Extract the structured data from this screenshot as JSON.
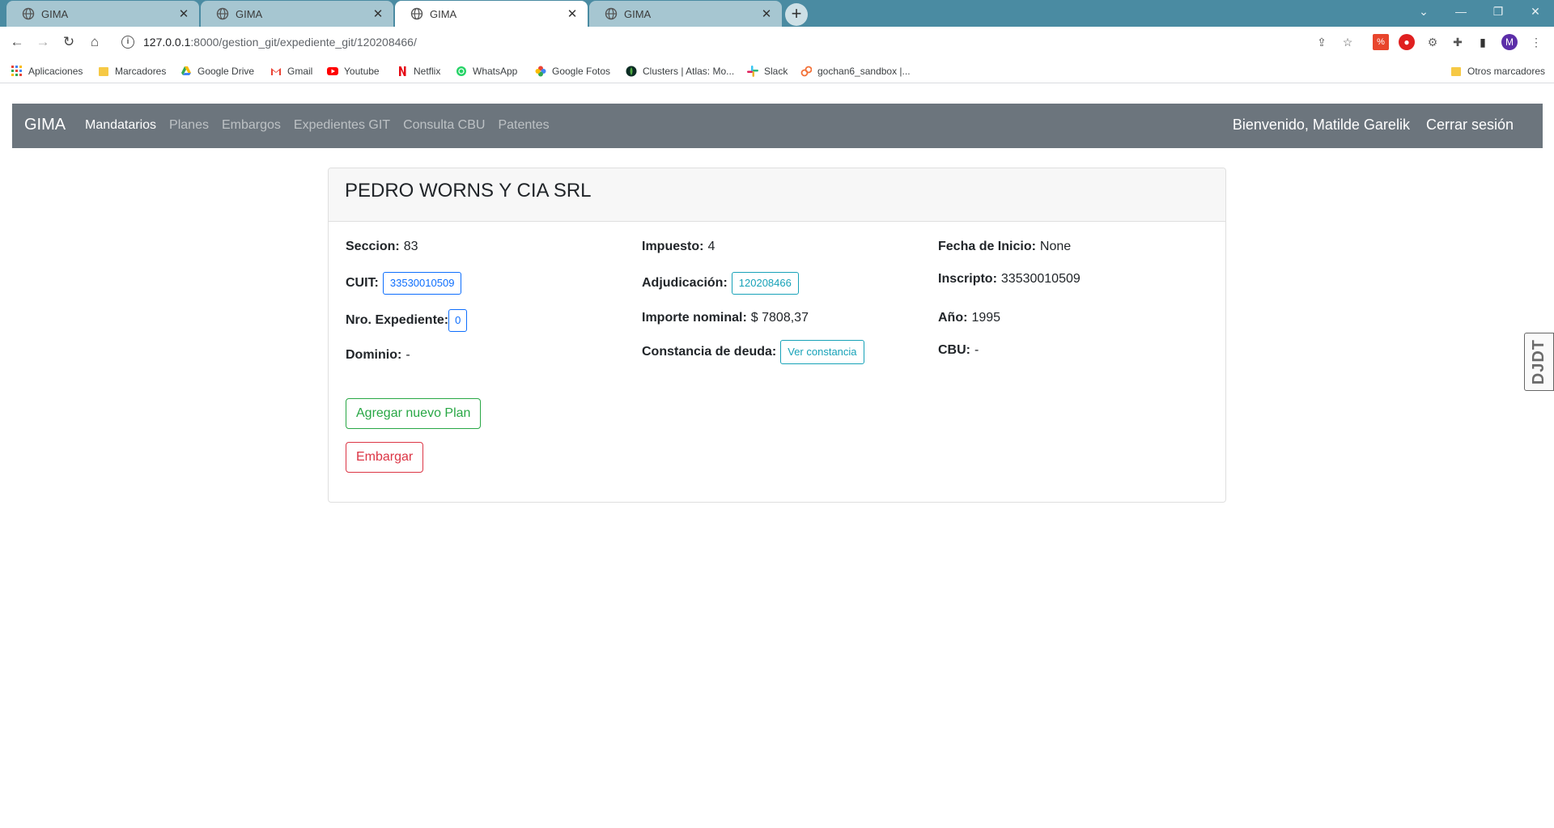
{
  "browser": {
    "tabs": [
      {
        "title": "GIMA",
        "active": false
      },
      {
        "title": "GIMA",
        "active": false
      },
      {
        "title": "GIMA",
        "active": true
      },
      {
        "title": "GIMA",
        "active": false
      }
    ],
    "url_host": "127.0.0.1",
    "url_rest": ":8000/gestion_git/expediente_git/120208466/",
    "profile_initial": "M",
    "bookmarks": [
      {
        "label": "Aplicaciones",
        "icon": "apps-grid-icon"
      },
      {
        "label": "Marcadores",
        "icon": "folder-icon"
      },
      {
        "label": "Google Drive",
        "icon": "google-drive-icon"
      },
      {
        "label": "Gmail",
        "icon": "gmail-icon"
      },
      {
        "label": "Youtube",
        "icon": "youtube-icon"
      },
      {
        "label": "Netflix",
        "icon": "netflix-icon"
      },
      {
        "label": "WhatsApp",
        "icon": "whatsapp-icon"
      },
      {
        "label": "Google Fotos",
        "icon": "google-photos-icon"
      },
      {
        "label": "Clusters | Atlas: Mo...",
        "icon": "mongodb-icon"
      },
      {
        "label": "Slack",
        "icon": "slack-icon"
      },
      {
        "label": "gochan6_sandbox |...",
        "icon": "postman-icon"
      }
    ],
    "other_bookmarks": "Otros marcadores"
  },
  "app": {
    "brand": "GIMA",
    "nav": [
      {
        "label": "Mandatarios",
        "active": true
      },
      {
        "label": "Planes",
        "active": false
      },
      {
        "label": "Embargos",
        "active": false
      },
      {
        "label": "Expedientes GIT",
        "active": false
      },
      {
        "label": "Consulta CBU",
        "active": false
      },
      {
        "label": "Patentes",
        "active": false
      }
    ],
    "welcome": "Bienvenido, Matilde Garelik",
    "logout": "Cerrar sesión"
  },
  "card": {
    "title": "PEDRO WORNS Y CIA SRL",
    "seccion_label": "Seccion:",
    "seccion_value": "83",
    "cuit_label": "CUIT:",
    "cuit_value": "33530010509",
    "expediente_label": "Nro. Expediente:",
    "expediente_value": "0",
    "dominio_label": "Dominio:",
    "dominio_value": "-",
    "impuesto_label": "Impuesto:",
    "impuesto_value": "4",
    "adjudicacion_label": "Adjudicación:",
    "adjudicacion_value": "120208466",
    "importe_label": "Importe nominal:",
    "importe_value": "$ 7808,37",
    "constancia_label": "Constancia de deuda:",
    "constancia_button": "Ver constancia",
    "fecha_label": "Fecha de Inicio:",
    "fecha_value": "None",
    "inscripto_label": "Inscripto:",
    "inscripto_value": "33530010509",
    "anio_label": "Año:",
    "anio_value": "1995",
    "cbu_label": "CBU:",
    "cbu_value": "-",
    "add_plan_button": "Agregar nuevo Plan",
    "embargar_button": "Embargar"
  },
  "widget": {
    "label": "DJDT"
  }
}
